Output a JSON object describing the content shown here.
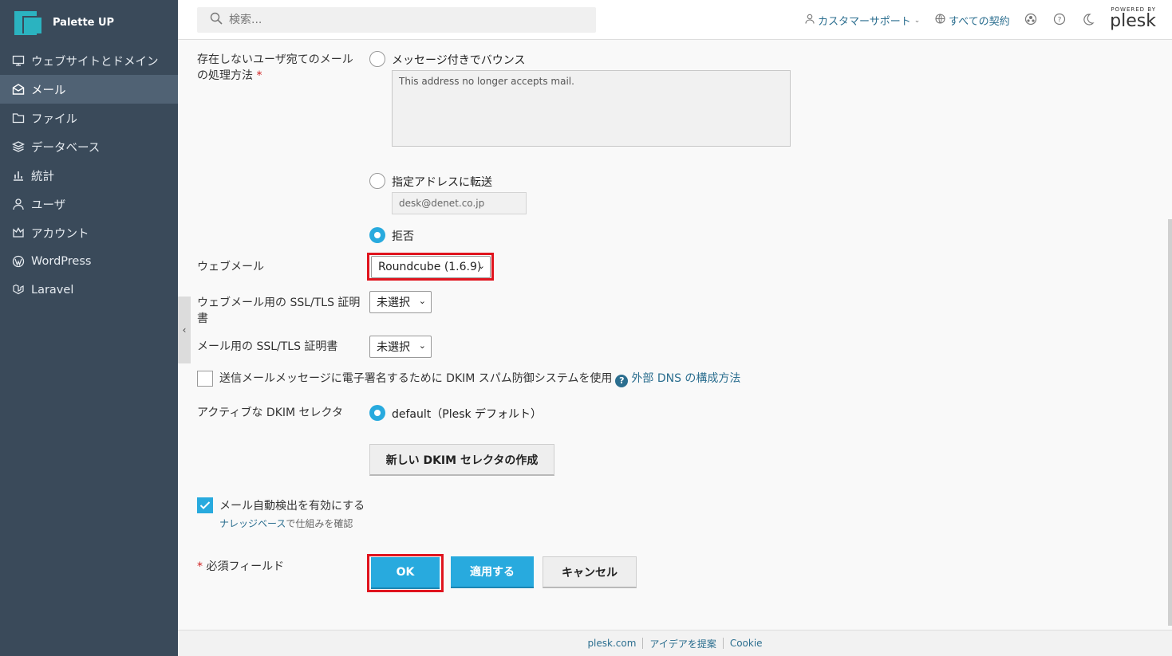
{
  "brand": {
    "name": "Palette UP"
  },
  "sidebar": {
    "items": [
      {
        "label": "ウェブサイトとドメイン",
        "icon": "monitor-icon"
      },
      {
        "label": "メール",
        "icon": "envelope-icon",
        "active": true
      },
      {
        "label": "ファイル",
        "icon": "folder-icon"
      },
      {
        "label": "データベース",
        "icon": "database-icon"
      },
      {
        "label": "統計",
        "icon": "bar-chart-icon"
      },
      {
        "label": "ユーザ",
        "icon": "user-icon"
      },
      {
        "label": "アカウント",
        "icon": "crown-icon"
      },
      {
        "label": "WordPress",
        "icon": "wordpress-icon"
      },
      {
        "label": "Laravel",
        "icon": "laravel-icon"
      }
    ]
  },
  "header": {
    "search_placeholder": "検索...",
    "support_label": "カスタマーサポート",
    "contracts_label": "すべての契約",
    "powered_by": "POWERED BY",
    "plesk": "plesk"
  },
  "form": {
    "nonexistent_label_line1": "存在しないユーザ宛てのメール",
    "nonexistent_label_line2": "の処理方法",
    "required_mark": "*",
    "opt_bounce": "メッセージ付きでバウンス",
    "bounce_message": "This address no longer accepts mail.",
    "opt_forward": "指定アドレスに転送",
    "forward_address": "desk@denet.co.jp",
    "opt_reject": "拒否",
    "webmail_label": "ウェブメール",
    "webmail_value": "Roundcube (1.6.9)",
    "webmail_ssl_label_line1": "ウェブメール用の SSL/TLS 証明",
    "webmail_ssl_label_line2": "書",
    "webmail_ssl_value": "未選択",
    "mail_ssl_label": "メール用の SSL/TLS 証明書",
    "mail_ssl_value": "未選択",
    "dkim_label": "送信メールメッセージに電子署名するために DKIM スパム防御システムを使用",
    "dkim_help": "?",
    "dkim_link": "外部 DNS の構成方法",
    "active_dkim_label": "アクティブな DKIM セレクタ",
    "dkim_default": "default（Plesk デフォルト）",
    "new_dkim_button": "新しい DKIM セレクタの作成",
    "autodiscover_label": "メール自動検出を有効にする",
    "kb_link": "ナレッジベース",
    "kb_suffix": "で仕組みを確認",
    "required_note": "必須フィールド",
    "ok_button": "OK",
    "apply_button": "適用する",
    "cancel_button": "キャンセル"
  },
  "footer": {
    "links": [
      "plesk.com",
      "アイデアを提案",
      "Cookie"
    ]
  },
  "colors": {
    "sidebar_bg": "#3a4a5a",
    "accent": "#28aade",
    "highlight": "#e0141e"
  }
}
